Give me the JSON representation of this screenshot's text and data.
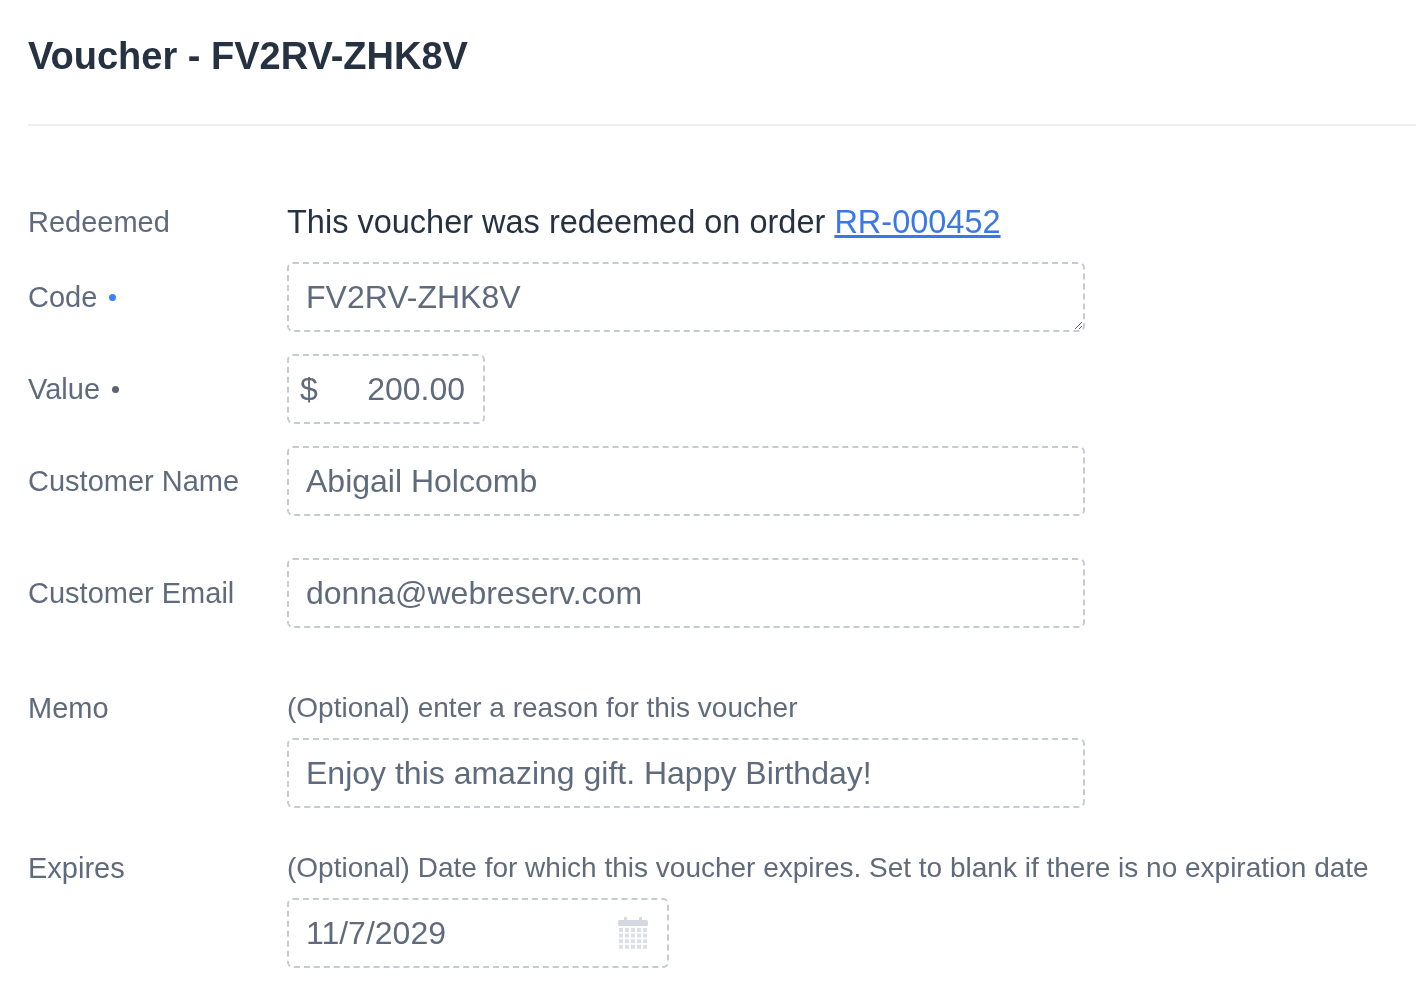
{
  "page": {
    "title": "Voucher - FV2RV-ZHK8V"
  },
  "fields": [
    {
      "kind": "note",
      "label": "Redeemed",
      "required": false,
      "text": "This voucher was redeemed on order",
      "link": "RR-000452"
    },
    {
      "kind": "textarea",
      "label": "Code",
      "required": true,
      "color": "#3b82f6",
      "value": "FV2RV-ZHK8V",
      "disabled": true
    },
    {
      "kind": "currency",
      "label": "Value",
      "required": true,
      "color": "#5a6472",
      "prefix": "$",
      "value": "200.00",
      "disabled": true
    },
    {
      "kind": "text",
      "label": "Customer Name",
      "required": false,
      "value": "Abigail Holcomb",
      "disabled": true
    },
    {
      "kind": "text",
      "label": "Customer Email",
      "required": false,
      "value": "donna@webreserv.com",
      "disabled": true
    },
    {
      "kind": "text",
      "label": "Memo",
      "required": false,
      "hint": "(Optional) enter a reason for this voucher",
      "value": "Enjoy this amazing gift. Happy Birthday!",
      "disabled": true
    },
    {
      "kind": "date",
      "label": "Expires",
      "required": false,
      "hint": "(Optional) Date for which this voucher expires. Set to blank if there is no expiration date",
      "value": "11/7/2029",
      "disabled": true
    }
  ]
}
